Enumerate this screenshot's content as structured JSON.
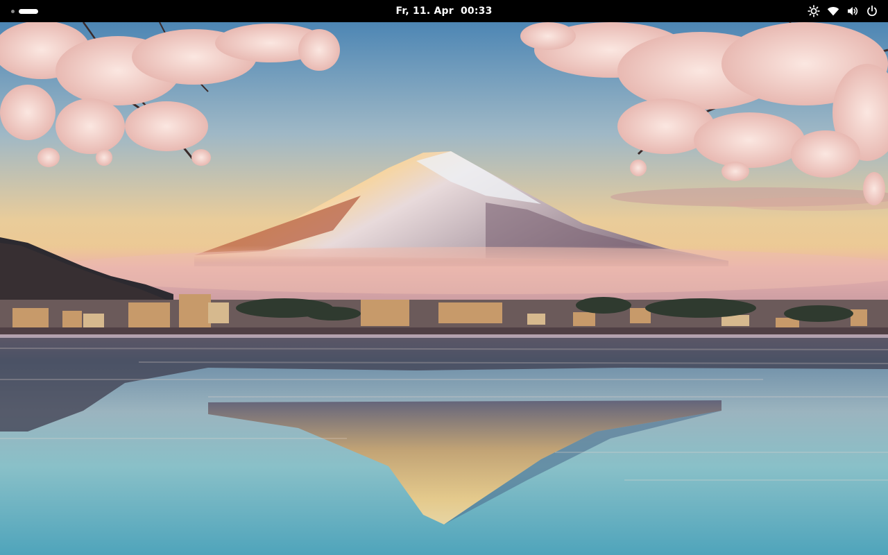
{
  "topbar": {
    "clock": "Fr, 11. Apr  00:33",
    "activities": {
      "icon": "workspace-indicator-icon"
    },
    "status": {
      "icons": [
        "brightness-icon",
        "wifi-icon",
        "volume-icon",
        "power-icon"
      ]
    }
  },
  "desktop": {
    "wallpaper": {
      "icon": "wallpaper-image"
    }
  },
  "colors": {
    "bar_background": "#000000",
    "bar_text": "#ffffff",
    "sky_top": "#4f88b6",
    "sky_horizon": "#f3c98e",
    "water": "#5fb0c2",
    "blossom": "#f4d6d0"
  }
}
